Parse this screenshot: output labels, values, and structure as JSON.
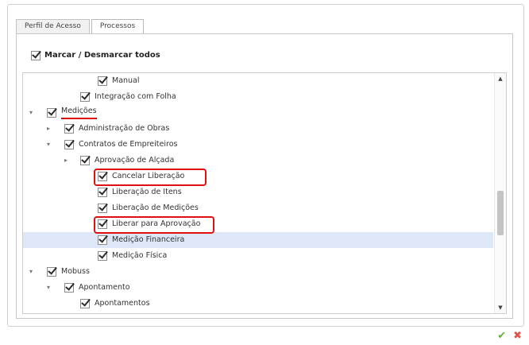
{
  "tabs": [
    {
      "label": "Perfil de Acesso",
      "active": false
    },
    {
      "label": "Processos",
      "active": true
    }
  ],
  "master_checkbox": {
    "label": "Marcar / Desmarcar todos",
    "checked": true
  },
  "tree": {
    "rows": [
      {
        "label": "Manual",
        "checked": true,
        "expander": ""
      },
      {
        "label": "Integração com Folha",
        "checked": true,
        "expander": ""
      },
      {
        "label": "Medições",
        "checked": true,
        "expander": "▾"
      },
      {
        "label": "Administração de Obras",
        "checked": true,
        "expander": "▸"
      },
      {
        "label": "Contratos de Empreiteiros",
        "checked": true,
        "expander": "▾"
      },
      {
        "label": "Aprovação de Alçada",
        "checked": true,
        "expander": "▸"
      },
      {
        "label": "Cancelar Liberação",
        "checked": true,
        "expander": ""
      },
      {
        "label": "Liberação de Itens",
        "checked": true,
        "expander": ""
      },
      {
        "label": "Liberação de Medições",
        "checked": true,
        "expander": ""
      },
      {
        "label": "Liberar para Aprovação",
        "checked": true,
        "expander": ""
      },
      {
        "label": "Medição Financeira",
        "checked": true,
        "expander": "",
        "selected": true
      },
      {
        "label": "Medição Física",
        "checked": true,
        "expander": ""
      },
      {
        "label": "Mobuss",
        "checked": true,
        "expander": "▾"
      },
      {
        "label": "Apontamento",
        "checked": true,
        "expander": "▾"
      },
      {
        "label": "Apontamentos",
        "checked": true,
        "expander": ""
      }
    ]
  },
  "scrollbar": {
    "up_glyph": "▲",
    "down_glyph": "▼"
  },
  "footer": {
    "ok_glyph": "✔",
    "cancel_glyph": "✖"
  },
  "colors": {
    "highlight": "#dde7f7",
    "annotation_red": "#e01010",
    "ok_green": "#62b33f",
    "cancel_red": "#d9534f"
  }
}
